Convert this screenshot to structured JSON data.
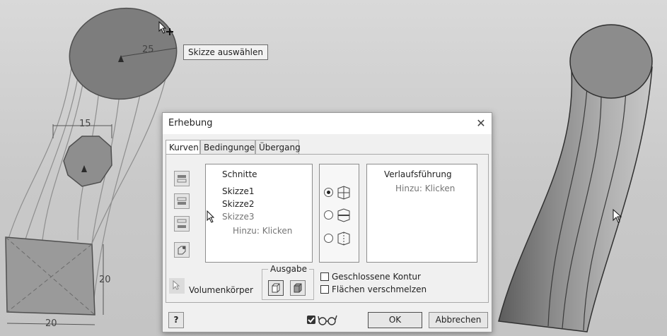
{
  "tooltip": {
    "text": "Skizze auswählen"
  },
  "dimensions": {
    "top_diameter": "25",
    "middle_diameter": "15",
    "bottom_height": "20",
    "bottom_width": "20"
  },
  "dialog": {
    "title": "Erhebung",
    "tabs": [
      {
        "label": "Kurven"
      },
      {
        "label": "Bedingungen"
      },
      {
        "label": "Übergang"
      }
    ],
    "sections": {
      "header": "Schnitte",
      "items": [
        "Skizze1",
        "Skizze2",
        "Skizze3"
      ],
      "add_hint": "Hinzu: Klicken"
    },
    "rails": {
      "header": "Verlaufsführung",
      "add_hint": "Hinzu: Klicken"
    },
    "output": {
      "label": "Ausgabe"
    },
    "solid_label": "Volumenkörper",
    "closed_loop_label": "Geschlossene Kontur",
    "merge_faces_label": "Flächen verschmelzen",
    "ok_label": "OK",
    "cancel_label": "Abbrechen",
    "help_label": "?"
  }
}
